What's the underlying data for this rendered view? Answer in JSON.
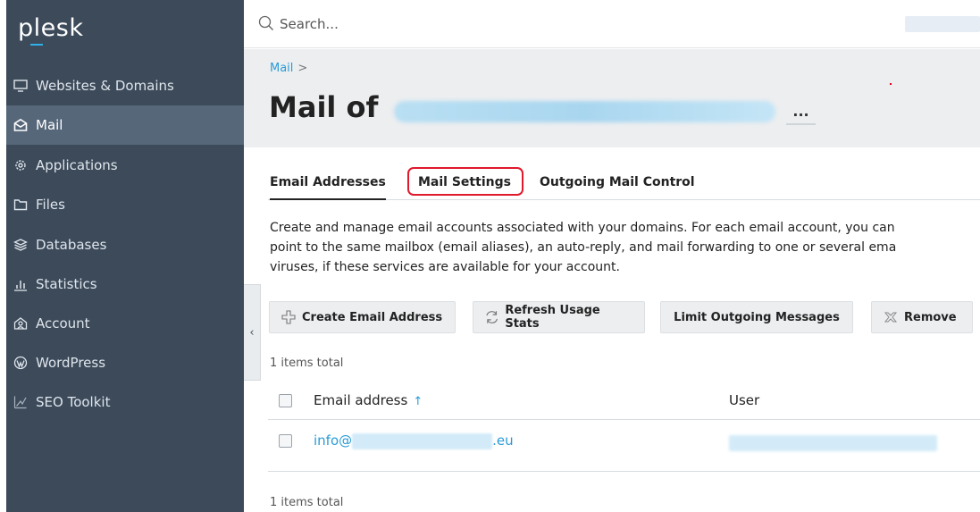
{
  "app": {
    "logo": "plesk",
    "accent": "#2fb0e6",
    "highlight": "#e0192c"
  },
  "sidebar": {
    "items": [
      {
        "label": "Websites & Domains",
        "icon": "monitor-icon"
      },
      {
        "label": "Mail",
        "icon": "mail-icon",
        "active": true
      },
      {
        "label": "Applications",
        "icon": "gear-icon"
      },
      {
        "label": "Files",
        "icon": "folder-icon"
      },
      {
        "label": "Databases",
        "icon": "database-icon"
      },
      {
        "label": "Statistics",
        "icon": "bar-chart-icon"
      },
      {
        "label": "Account",
        "icon": "account-icon"
      },
      {
        "label": "WordPress",
        "icon": "wordpress-icon"
      },
      {
        "label": "SEO Toolkit",
        "icon": "seo-icon"
      }
    ]
  },
  "search": {
    "placeholder": "Search..."
  },
  "header": {
    "breadcrumb": "Mail",
    "breadcrumb_sep": ">",
    "title_prefix": "Mail of",
    "more": "..."
  },
  "tabs": [
    {
      "label": "Email Addresses",
      "active": true
    },
    {
      "label": "Mail Settings",
      "highlighted": true
    },
    {
      "label": "Outgoing Mail Control"
    }
  ],
  "description": {
    "line1": "Create and manage email accounts associated with your domains. For each email account, you can",
    "line2": "point to the same mailbox (email aliases), an auto-reply, and mail forwarding to one or several ema",
    "line3": "viruses, if these services are available for your account."
  },
  "toolbar": {
    "create": "Create Email Address",
    "refresh": "Refresh Usage Stats",
    "limit": "Limit Outgoing Messages",
    "remove": "Remove"
  },
  "table": {
    "count_top": "1 items total",
    "count_bottom": "1 items total",
    "columns": {
      "email": "Email address",
      "sort": "↑",
      "user": "User"
    },
    "rows": [
      {
        "email_prefix": "info@",
        "email_suffix": ".eu"
      }
    ]
  }
}
